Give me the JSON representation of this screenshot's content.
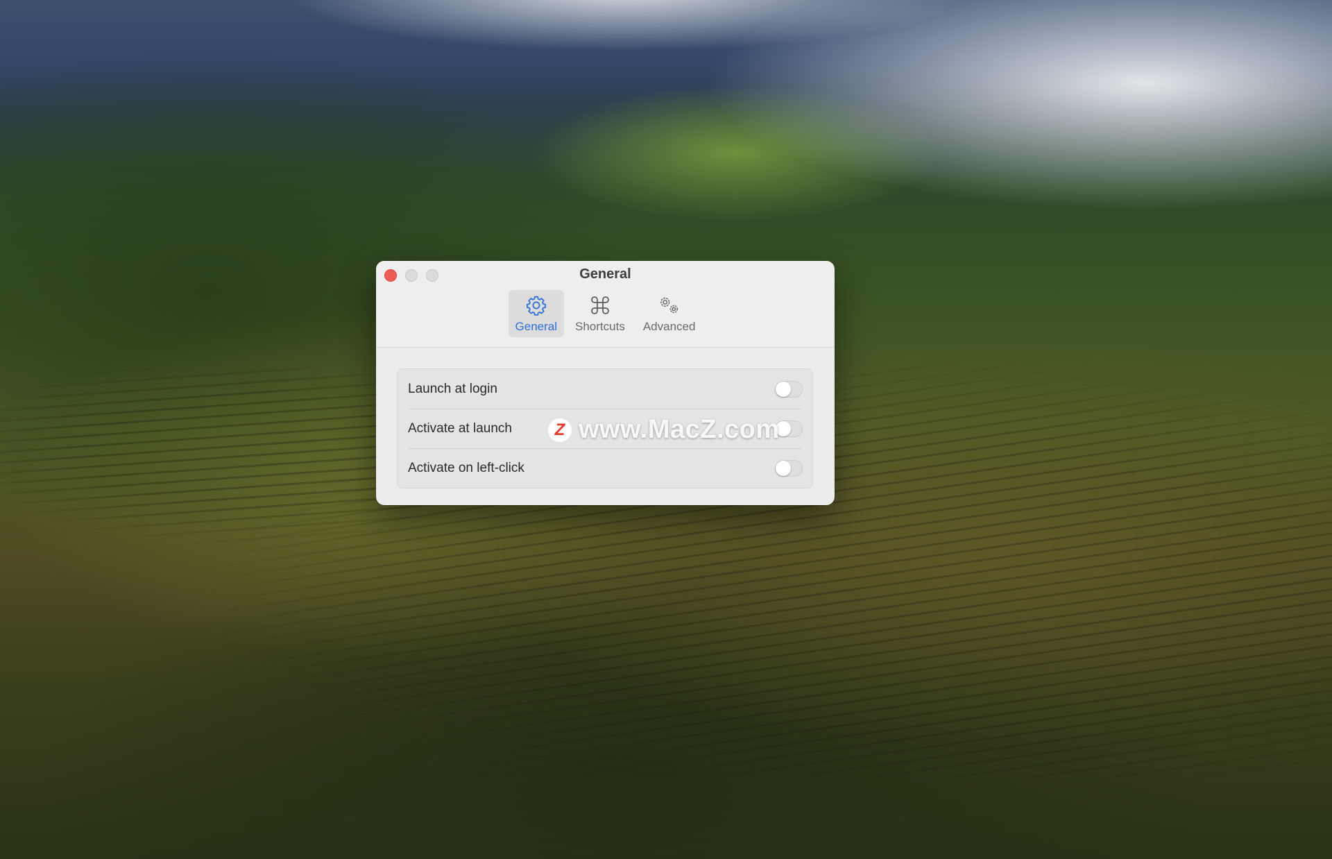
{
  "window": {
    "title": "General",
    "controls": [
      "close",
      "minimize",
      "zoom"
    ]
  },
  "toolbar": {
    "tabs": [
      {
        "label": "General",
        "icon": "gear-icon",
        "selected": true
      },
      {
        "label": "Shortcuts",
        "icon": "command-icon",
        "selected": false
      },
      {
        "label": "Advanced",
        "icon": "gears-icon",
        "selected": false
      }
    ]
  },
  "settings": {
    "rows": [
      {
        "label": "Launch at login",
        "enabled": false
      },
      {
        "label": "Activate at launch",
        "enabled": false
      },
      {
        "label": "Activate on left-click",
        "enabled": false
      }
    ]
  },
  "watermark": {
    "logo_letter": "Z",
    "text": "www.MacZ.com"
  },
  "colors": {
    "accent": "#2d6ed8",
    "close": "#ee5d55",
    "window_bg": "#ececec"
  }
}
